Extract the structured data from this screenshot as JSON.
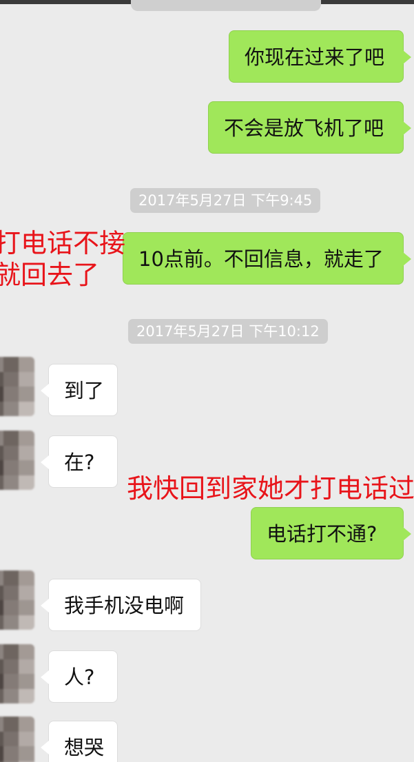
{
  "messages": {
    "m1": "你现在过来了吧",
    "m2": "不会是放飞机了吧",
    "m3": "10点前。不回信息，就走了",
    "m4": "到了",
    "m5": "在?",
    "m6": "电话打不通?",
    "m7": "我手机没电啊",
    "m8": "人?",
    "m9": "想哭"
  },
  "timestamps": {
    "t1": "2017年5月27日 下午9:45",
    "t2": "2017年5月27日 下午10:12"
  },
  "annotations": {
    "a1_line1": "打电话不接",
    "a1_line2": "就回去了",
    "a2": "我快回到家她才打电话过"
  },
  "colors": {
    "outgoing_bubble": "#a0e75a",
    "incoming_bubble": "#ffffff",
    "annotation_text": "#e8141a",
    "background": "#ebebeb",
    "timestamp_pill": "#cecece"
  }
}
